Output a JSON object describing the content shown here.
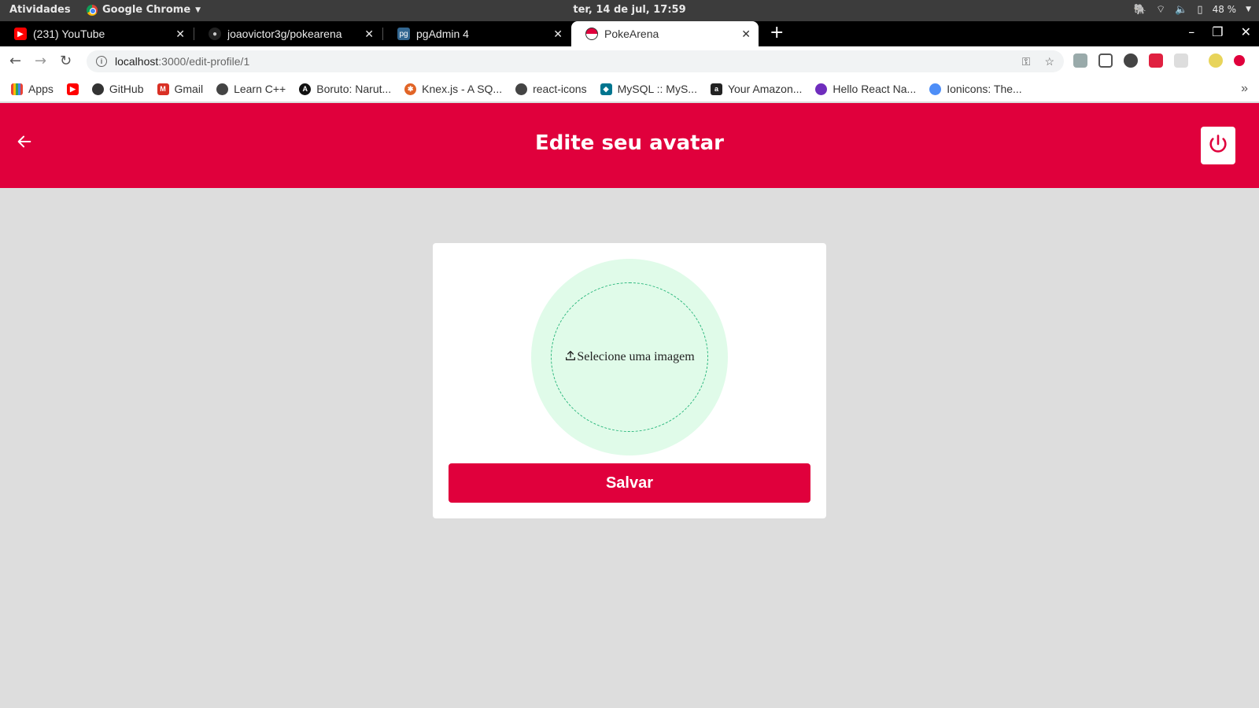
{
  "system": {
    "activities": "Atividades",
    "app_name": "Google Chrome",
    "clock": "ter, 14 de jul, 17:59",
    "battery": "48 %"
  },
  "tabs": [
    {
      "title": "(231) YouTube",
      "icon": "youtube-icon"
    },
    {
      "title": "joaovictor3g/pokearena",
      "icon": "github-icon"
    },
    {
      "title": "pgAdmin 4",
      "icon": "pgadmin-icon"
    },
    {
      "title": "PokeArena",
      "icon": "pokeball-icon"
    }
  ],
  "address": {
    "host": "localhost",
    "path": ":3000/edit-profile/1"
  },
  "bookmarks": [
    {
      "label": "Apps",
      "color": "#4285f4"
    },
    {
      "label": "",
      "color": "#ff0000"
    },
    {
      "label": "GitHub",
      "color": "#333333"
    },
    {
      "label": "Gmail",
      "color": "#d93025"
    },
    {
      "label": "Learn C++",
      "color": "#444444"
    },
    {
      "label": "Boruto: Narut...",
      "color": "#111111"
    },
    {
      "label": "Knex.js - A SQ...",
      "color": "#e16426"
    },
    {
      "label": "react-icons",
      "color": "#444444"
    },
    {
      "label": "MySQL :: MyS...",
      "color": "#00758f"
    },
    {
      "label": "Your Amazon...",
      "color": "#222222"
    },
    {
      "label": "Hello React Na...",
      "color": "#6f2dbd"
    },
    {
      "label": "Ionicons: The...",
      "color": "#4e8ef7"
    }
  ],
  "page": {
    "title": "Edite seu avatar",
    "upload_label": "Selecione uma imagem",
    "save_label": "Salvar"
  },
  "colors": {
    "brand": "#e0003c",
    "avatar_bg": "#e0fbe9",
    "avatar_border": "#2db87e"
  }
}
